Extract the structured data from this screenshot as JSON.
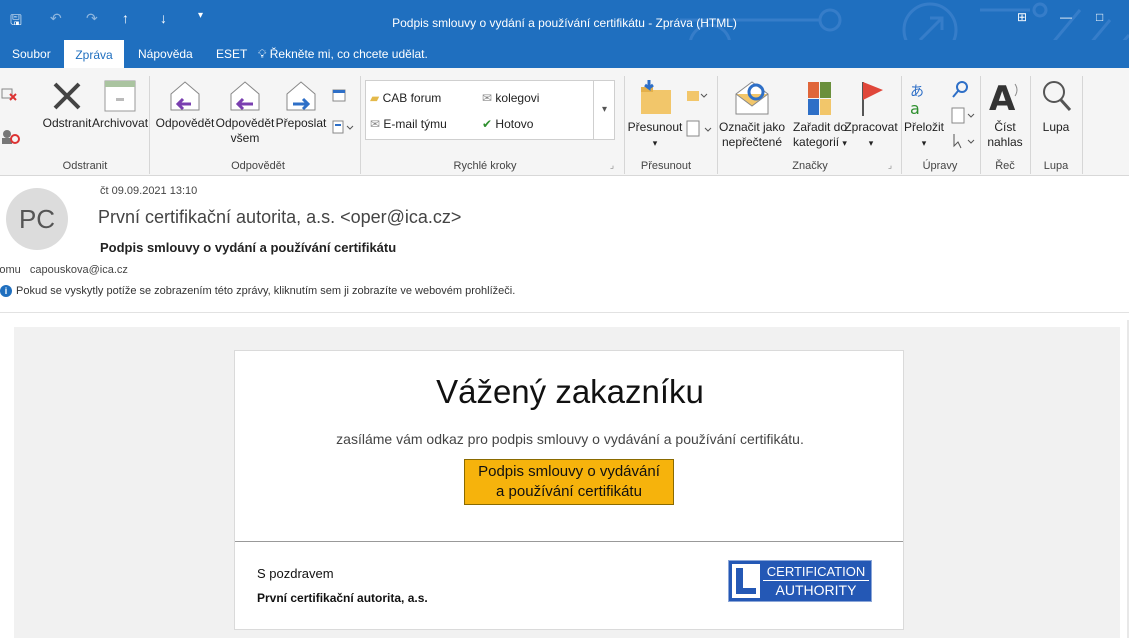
{
  "window": {
    "title": "Podpis smlouvy o vydání a používání certifikátu  -  Zpráva (HTML)"
  },
  "quick_access": {
    "save_icon": "save-icon",
    "undo_icon": "undo-icon",
    "redo_icon": "redo-icon",
    "up_icon": "arrow-up-icon",
    "down_icon": "arrow-down-icon"
  },
  "tabs": {
    "soubor": "Soubor",
    "zprava": "Zpráva",
    "napoveda": "Nápověda",
    "eset": "ESET",
    "tell_me": "Řekněte mi, co chcete udělat."
  },
  "ribbon": {
    "delete": "Odstranit",
    "archive": "Archivovat",
    "reply": "Odpovědět",
    "reply_all_1": "Odpovědět",
    "reply_all_2": "všem",
    "forward": "Přeposlat",
    "qs_cab": "CAB forum",
    "qs_colleagues": "kolegovi",
    "qs_email_team": "E-mail týmu",
    "qs_done": "Hotovo",
    "move": "Přesunout",
    "mark_unread_1": "Označit jako",
    "mark_unread_2": "nepřečtené",
    "categorize_1": "Zařadit do",
    "categorize_2": "kategorií",
    "followup": "Zpracovat",
    "translate": "Přeložit",
    "read_aloud_1": "Číst",
    "read_aloud_2": "nahlas",
    "zoom": "Lupa",
    "groups": {
      "delete": "Odstranit",
      "respond": "Odpovědět",
      "quick_steps": "Rychlé kroky",
      "move": "Přesunout",
      "tags": "Značky",
      "editing": "Úpravy",
      "speech": "Řeč",
      "zoom": "Lupa"
    }
  },
  "message": {
    "avatar": "PC",
    "date": "čt 09.09.2021 13:10",
    "from": "První certifikační autorita, a.s. <oper@ica.cz>",
    "subject": "Podpis smlouvy o vydání a používání certifikátu",
    "to_label": "Komu",
    "to": "capouskova@ica.cz",
    "info_bar": "Pokud se vyskytly potíže se zobrazením této zprávy, kliknutím sem ji zobrazíte ve webovém prohlížeči."
  },
  "email_body": {
    "greeting": "Vážený zakazníku",
    "lead": "zasíláme vám odkaz pro podpis smlouvy o vydávání a používání certifikátu.",
    "cta_line1": "Podpis smlouvy o vydávání",
    "cta_line2": "a používání certifikátu",
    "regards": "S pozdravem",
    "company": "První certifikační autorita, a.s.",
    "logo_line1": "CERTIFICATION",
    "logo_line2": "AUTHORITY"
  },
  "colors": {
    "accent": "#1f6fbf",
    "cta": "#f6b30c",
    "logo": "#2458b5"
  }
}
